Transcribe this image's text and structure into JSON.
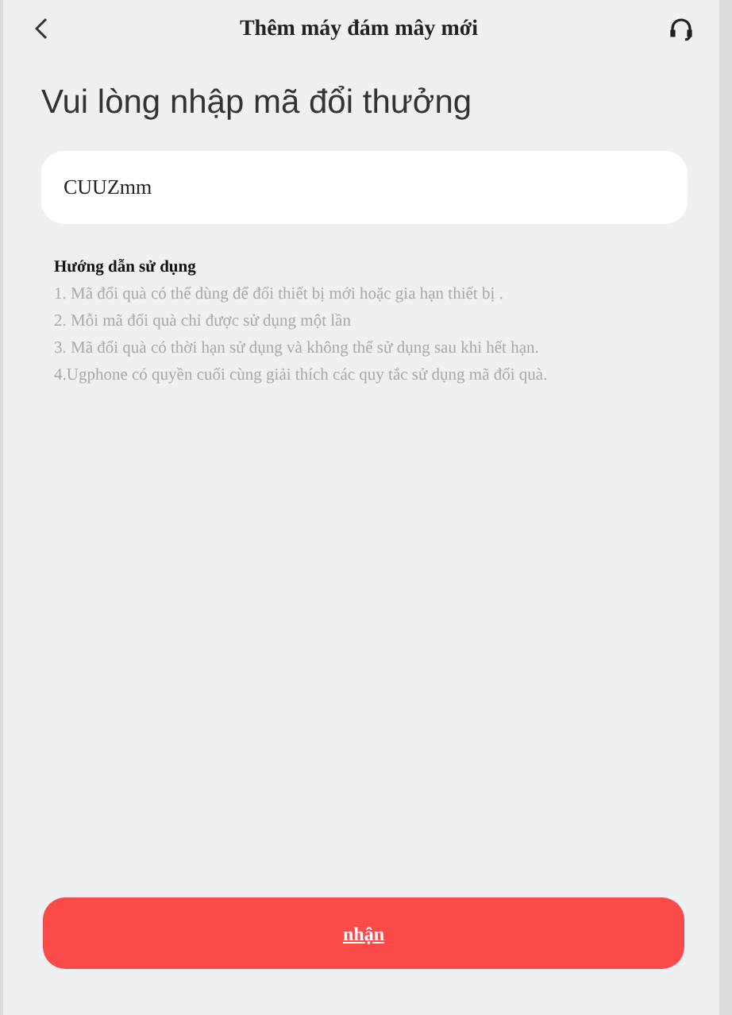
{
  "header": {
    "title": "Thêm máy đám mây mới"
  },
  "heading": "Vui lòng nhập mã đổi thưởng",
  "code_field": {
    "value": "CUUZmm"
  },
  "instructions": {
    "title": "Hướng dẫn sử dụng",
    "lines": [
      "1. Mã đổi quà có thể dùng để đổi thiết bị mới hoặc gia hạn thiết bị .",
      "2. Mỗi mã đổi quà chỉ được sử dụng một lần",
      "3. Mã đổi quà có thời hạn sử dụng và không thể sử dụng sau khi hết hạn.",
      "4.Ugphone có quyền cuối cùng giải thích các quy tắc sử dụng mã đổi quà."
    ]
  },
  "submit_button": {
    "label": "nhận"
  }
}
